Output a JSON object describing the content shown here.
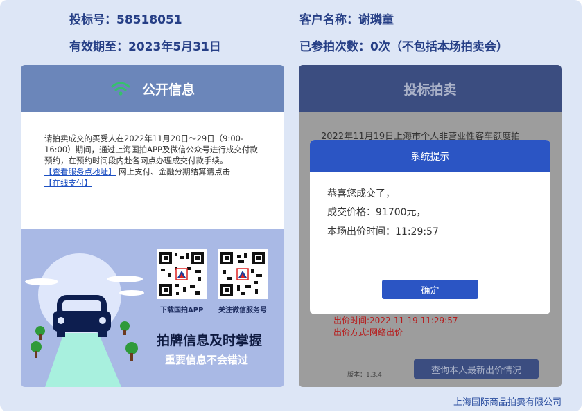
{
  "header": {
    "bid_no": "投标号：58518051",
    "customer": "客户名称：谢璘童",
    "valid_until": "有效期至：2023年5月31日",
    "auction_count": "已参拍次数：0次（不包括本场拍卖会）"
  },
  "left_panel": {
    "title": "公开信息",
    "body_text": "请拍卖成交的买受人在2022年11月20日～29日（9:00-16:00）期间，通过上海国拍APP及微信公众号进行成交付款预约，在预约时间段内赴各网点办理成交付款手续。",
    "service_link": "【查看服务点地址】",
    "after_link": "网上支付、金融分期结算请点击",
    "pay_link": "【在线支付】",
    "qr1_label": "下载国拍APP",
    "qr2_label": "关注微信服务号",
    "slogan": "拍牌信息及时掌握",
    "slogan_sub": "重要信息不会错过"
  },
  "right_panel": {
    "title": "投标拍卖",
    "faded_text": "2022年11月19日上海市个人非营业性客车额度拍",
    "bid_time": "出价时间:2022-11-19 11:29:57",
    "bid_method": "出价方式:网络出价",
    "version": "版本：1.3.4",
    "query_button": "查询本人最新出价情况"
  },
  "modal": {
    "title": "系统提示",
    "line1": "恭喜您成交了，",
    "line2": "成交价格：91700元，",
    "line3": "本场出价时间：11:29:57",
    "ok": "确定"
  },
  "footer": "上海国际商品拍卖有限公司",
  "colors": {
    "frame": "#dde6f6",
    "header_text": "#263f86",
    "left_title_bg": "#6b86ba",
    "right_title_bg": "#3b4d80",
    "modal_accent": "#2b55c4",
    "wifi_green": "#35c26b"
  }
}
